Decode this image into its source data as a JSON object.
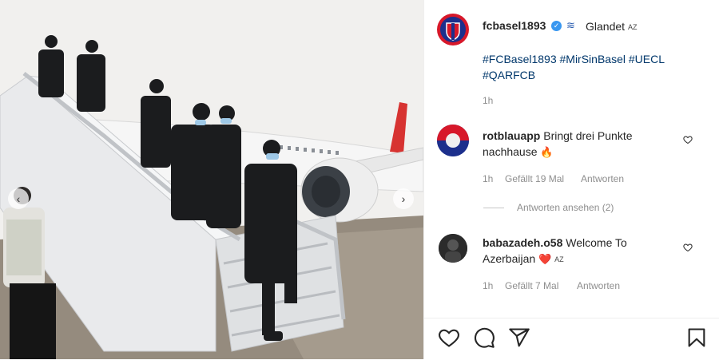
{
  "caption": {
    "username": "fcbasel1893",
    "location": "Glandet",
    "location_badge": "AZ",
    "hashtags": "#FCBasel1893 #MirSinBasel #UECL #QARFCB",
    "time": "1h"
  },
  "comments": [
    {
      "username": "rotblauapp",
      "text": "Bringt drei Punkte nachhause",
      "emoji": "🔥",
      "time": "1h",
      "likes": "Gefällt 19 Mal",
      "reply_label": "Antworten",
      "view_replies": "Antworten ansehen (2)"
    },
    {
      "username": "babazadeh.o58",
      "text": "Welcome To Azerbaijan",
      "emoji": "❤️",
      "badge": "AZ",
      "time": "1h",
      "likes": "Gefällt 7 Mal",
      "reply_label": "Antworten"
    }
  ],
  "colors": {
    "link": "#00376b",
    "muted": "#8e8e8e",
    "club_red": "#d7182a",
    "club_blue": "#1c2f8c",
    "verified": "#3897f0"
  },
  "icons": [
    "heart-icon",
    "comment-icon",
    "share-icon",
    "bookmark-icon",
    "chevron-left-icon",
    "chevron-right-icon",
    "verified-icon",
    "wave-icon"
  ]
}
